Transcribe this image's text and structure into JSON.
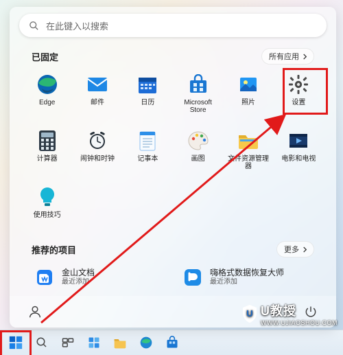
{
  "search": {
    "placeholder": "在此键入以搜索"
  },
  "pinned": {
    "header": "已固定",
    "all_apps_label": "所有应用",
    "apps": [
      {
        "key": "edge",
        "label": "Edge"
      },
      {
        "key": "mail",
        "label": "邮件"
      },
      {
        "key": "calendar",
        "label": "日历"
      },
      {
        "key": "store",
        "label": "Microsoft Store"
      },
      {
        "key": "photos",
        "label": "照片"
      },
      {
        "key": "settings",
        "label": "设置"
      },
      {
        "key": "calculator",
        "label": "计算器"
      },
      {
        "key": "alarms",
        "label": "闹钟和时钟"
      },
      {
        "key": "notepad",
        "label": "记事本"
      },
      {
        "key": "paint",
        "label": "画图"
      },
      {
        "key": "explorer",
        "label": "文件资源管理器"
      },
      {
        "key": "movies",
        "label": "电影和电视"
      },
      {
        "key": "tips",
        "label": "使用技巧"
      }
    ]
  },
  "recommended": {
    "header": "推荐的项目",
    "more_label": "更多",
    "items": [
      {
        "key": "wps",
        "title": "金山文档",
        "subtitle": "最近添加"
      },
      {
        "key": "recovery",
        "title": "嗨格式数据恢复大师",
        "subtitle": "最近添加"
      }
    ]
  },
  "watermark": {
    "brand": "U教授",
    "url": "WWW.UJIAOSHOU.COM"
  },
  "colors": {
    "annotation": "#e11a1a",
    "accent": "#0078d4"
  }
}
